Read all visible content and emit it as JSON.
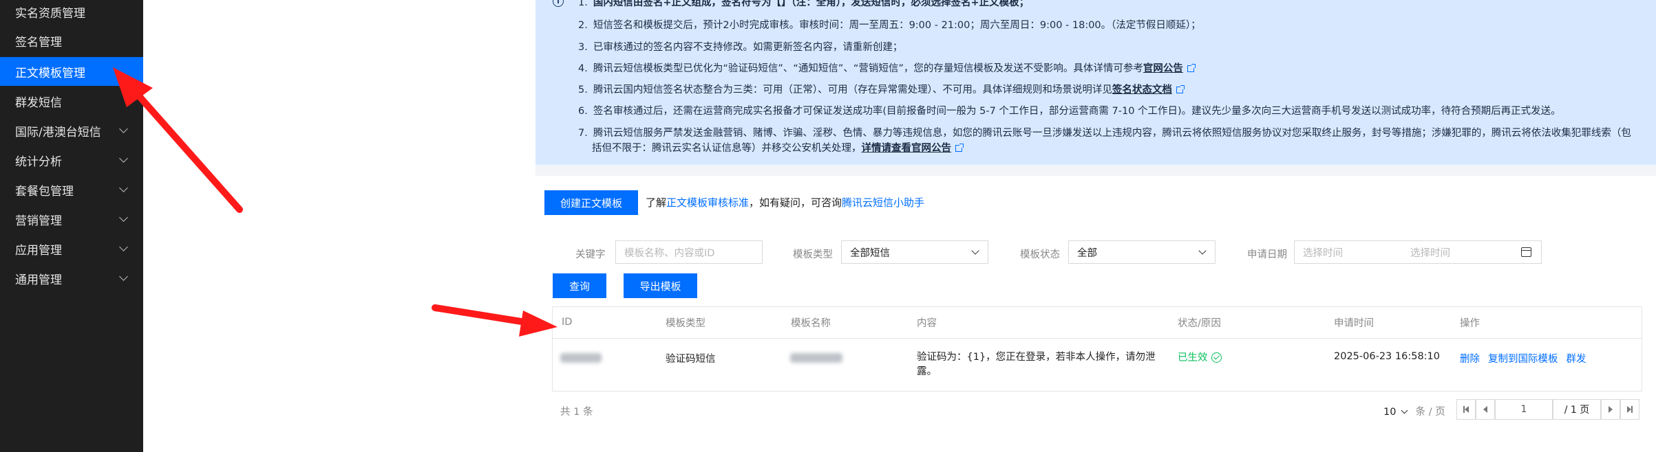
{
  "sidebar": {
    "items": [
      {
        "label": "实名资质管理",
        "active": false,
        "expandable": false
      },
      {
        "label": "签名管理",
        "active": false,
        "expandable": false
      },
      {
        "label": "正文模板管理",
        "active": true,
        "expandable": false
      },
      {
        "label": "群发短信",
        "active": false,
        "expandable": false
      },
      {
        "label": "国际/港澳台短信",
        "active": false,
        "expandable": true
      },
      {
        "label": "统计分析",
        "active": false,
        "expandable": true
      },
      {
        "label": "套餐包管理",
        "active": false,
        "expandable": true
      },
      {
        "label": "营销管理",
        "active": false,
        "expandable": true
      },
      {
        "label": "应用管理",
        "active": false,
        "expandable": true
      },
      {
        "label": "通用管理",
        "active": false,
        "expandable": true
      }
    ]
  },
  "notice": {
    "info_icon": "info-icon",
    "lines": [
      {
        "num": "1.",
        "text": "国内短信由签名+正文组成，签名符号为【】（注：全角），发送短信时，必须选择签名+正文模板；"
      },
      {
        "num": "2.",
        "text": "短信签名和模板提交后，预计2小时完成审核。审核时间：周一至周五：9:00 - 21:00；周六至周日：9:00 - 18:00。（法定节假日顺延）；"
      },
      {
        "num": "3.",
        "text": "已审核通过的签名内容不支持修改。如需更新签名内容，请重新创建；"
      },
      {
        "num": "4.",
        "text": "腾讯云短信模板类型已优化为“验证码短信”、“通知短信”、“营销短信”，您的存量短信模板及发送不受影响。具体详情可参考",
        "link": "官网公告"
      },
      {
        "num": "5.",
        "text": "腾讯云国内短信签名状态整合为三类：可用（正常）、可用（存在异常需处理）、不可用。具体详细规则和场景说明详见",
        "link": "签名状态文档"
      },
      {
        "num": "6.",
        "text": "签名审核通过后，还需在运营商完成实名报备才可保证发送成功率(目前报备时间一般为 5-7 个工作日，部分运营商需 7-10 个工作日)。建议先少量多次向三大运营商手机号发送以测试成功率，待符合预期后再正式发送。"
      },
      {
        "num": "7.",
        "text": "腾讯云短信服务严禁发送金融营销、赌博、诈骗、淫秽、色情、暴力等违规信息，如您的腾讯云账号一旦涉嫌发送以上违规内容，腾讯云将依照短信服务协议对您采取终止服务，封号等措施；涉嫌犯罪的，腾讯云将依法收集犯罪线索（包",
        "text2": "括但不限于：腾讯云实名认证信息等）并移交公安机关处理，",
        "link": "详情请查看官网公告"
      }
    ]
  },
  "toolbar": {
    "create_label": "创建正文模板",
    "hint_prefix": "了解",
    "hint_link1": "正文模板审核标准",
    "hint_middle": "，如有疑问，可咨询",
    "hint_link2": "腾讯云短信小助手"
  },
  "filters": {
    "keyword_label": "关键字",
    "keyword_placeholder": "模板名称、内容或ID",
    "type_label": "模板类型",
    "type_value": "全部短信",
    "status_label": "模板状态",
    "status_value": "全部",
    "date_label": "申请日期",
    "date_start_placeholder": "选择时间",
    "date_end_placeholder": "选择时间",
    "query_label": "查询",
    "export_label": "导出模板"
  },
  "table": {
    "columns": [
      "ID",
      "模板类型",
      "模板名称",
      "内容",
      "状态/原因",
      "申请时间",
      "操作"
    ],
    "rows": [
      {
        "id": "",
        "type": "验证码短信",
        "name": "",
        "content_line1": "验证码为：{1}，您正在登录，若非本人操作，请勿泄",
        "content_line2": "露。",
        "status": "已生效",
        "time": "2025-06-23 16:58:10",
        "actions": [
          "删除",
          "复制到国际模板",
          "群发"
        ]
      }
    ]
  },
  "pagination": {
    "total": "共 1 条",
    "page_size": "10",
    "page_size_unit": "条 / 页",
    "current_page": "1",
    "total_pages": "/ 1 页"
  },
  "colors": {
    "accent": "#006eff",
    "sidebar_bg": "#1f1f1f",
    "notice_bg": "#d8e9ff",
    "success": "#0abf5b",
    "annotation_arrow": "#ff1a1a"
  }
}
